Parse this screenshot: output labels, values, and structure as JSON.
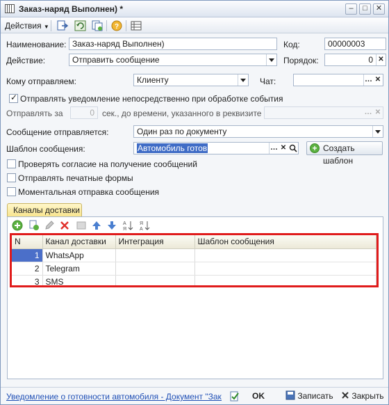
{
  "window": {
    "title": "Заказ-наряд Выполнен) *"
  },
  "toolbar": {
    "actions_label": "Действия"
  },
  "form": {
    "name_label": "Наименование:",
    "name_value": "Заказ-наряд Выполнен)",
    "code_label": "Код:",
    "code_value": "00000003",
    "action_label": "Действие:",
    "action_value": "Отправить сообщение",
    "order_label": "Порядок:",
    "order_value": "0",
    "recipient_label": "Кому отправляем:",
    "recipient_value": "Клиенту",
    "chat_label": "Чат:",
    "chat_value": "",
    "notify_checkbox_label": "Отправлять уведомление непосредственно при обработке события",
    "notify_checked": true,
    "send_before_label": "Отправлять за",
    "send_before_value": "0",
    "send_before_suffix": "сек., до времени, указанного в реквизите",
    "send_mode_label": "Сообщение отправляется:",
    "send_mode_value": "Один раз по документу",
    "template_label": "Шаблон сообщения:",
    "template_value": "Автомобиль готов",
    "create_template_label": "Создать шаблон",
    "checkbox_consent": "Проверять согласие на получение сообщений",
    "checkbox_print_forms": "Отправлять печатные формы",
    "checkbox_instant": "Моментальная отправка сообщения"
  },
  "tabs": {
    "delivery_channels": "Каналы доставки"
  },
  "grid": {
    "columns": [
      "N",
      "Канал доставки",
      "Интеграция",
      "Шаблон сообщения"
    ],
    "rows": [
      {
        "n": "1",
        "channel": "WhatsApp",
        "integration": "",
        "template": ""
      },
      {
        "n": "2",
        "channel": "Telegram",
        "integration": "",
        "template": ""
      },
      {
        "n": "3",
        "channel": "SMS",
        "integration": "",
        "template": ""
      }
    ]
  },
  "status": {
    "link": "Уведомление о готовности автомобиля - Документ \"Заказ-наряд\"",
    "ok_label": "OK",
    "save_label": "Записать",
    "close_label": "Закрыть"
  },
  "colors": {
    "highlight_border": "#e01b1b",
    "selected_row": "#4b6fc9",
    "tab_fill": "#f8e48b"
  }
}
